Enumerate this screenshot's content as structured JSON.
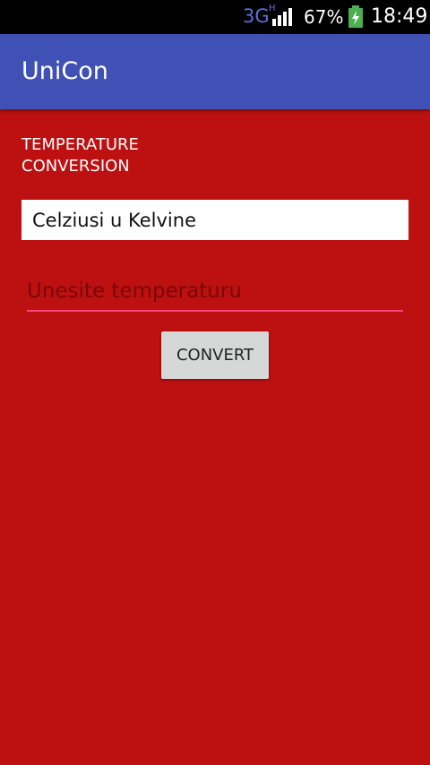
{
  "status_bar": {
    "network": "3G",
    "network_sub": "H",
    "battery_percent": "67%",
    "time": "18:49",
    "network_color": "#5b6fe0",
    "battery_color": "#4CAF50"
  },
  "app_bar": {
    "title": "UniCon",
    "color": "#3F51B5"
  },
  "main": {
    "background": "#BD1010",
    "section_title": "TEMPERATURE\nCONVERSION",
    "conversion_select": {
      "selected": "Celziusi u Kelvine"
    },
    "temperature_input": {
      "value": "",
      "placeholder": "Unesite temperaturu",
      "underline_color": "#FF4081"
    },
    "convert_button": {
      "label": "CONVERT"
    }
  }
}
